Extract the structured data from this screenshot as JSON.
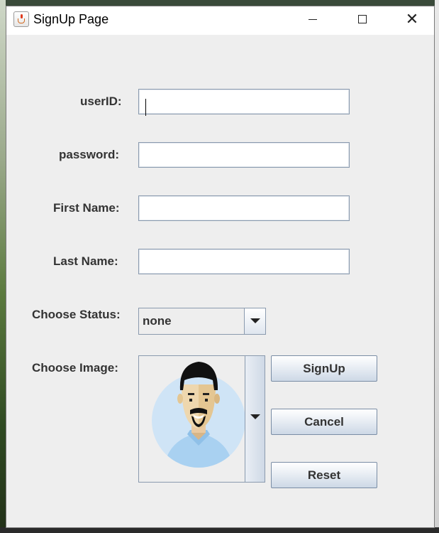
{
  "window": {
    "title": "SignUp Page",
    "title_icon": "java-cup-icon",
    "controls": {
      "minimize": "minimize-icon",
      "maximize": "maximize-icon",
      "close": "close-icon"
    }
  },
  "form": {
    "userid_label": "userID:",
    "password_label": "password:",
    "firstname_label": "First Name:",
    "lastname_label": "Last Name:",
    "status_label": "Choose Status:",
    "image_label": "Choose Image:",
    "userid_value": "",
    "password_value": "",
    "firstname_value": "",
    "lastname_value": "",
    "status_selected": "none"
  },
  "buttons": {
    "signup": "SignUp",
    "cancel": "Cancel",
    "reset": "Reset"
  },
  "colors": {
    "window_bg": "#eeeeee",
    "field_border": "#8a9aae",
    "avatar_circle": "#cfe4f6",
    "shirt": "#a9d1f1"
  }
}
